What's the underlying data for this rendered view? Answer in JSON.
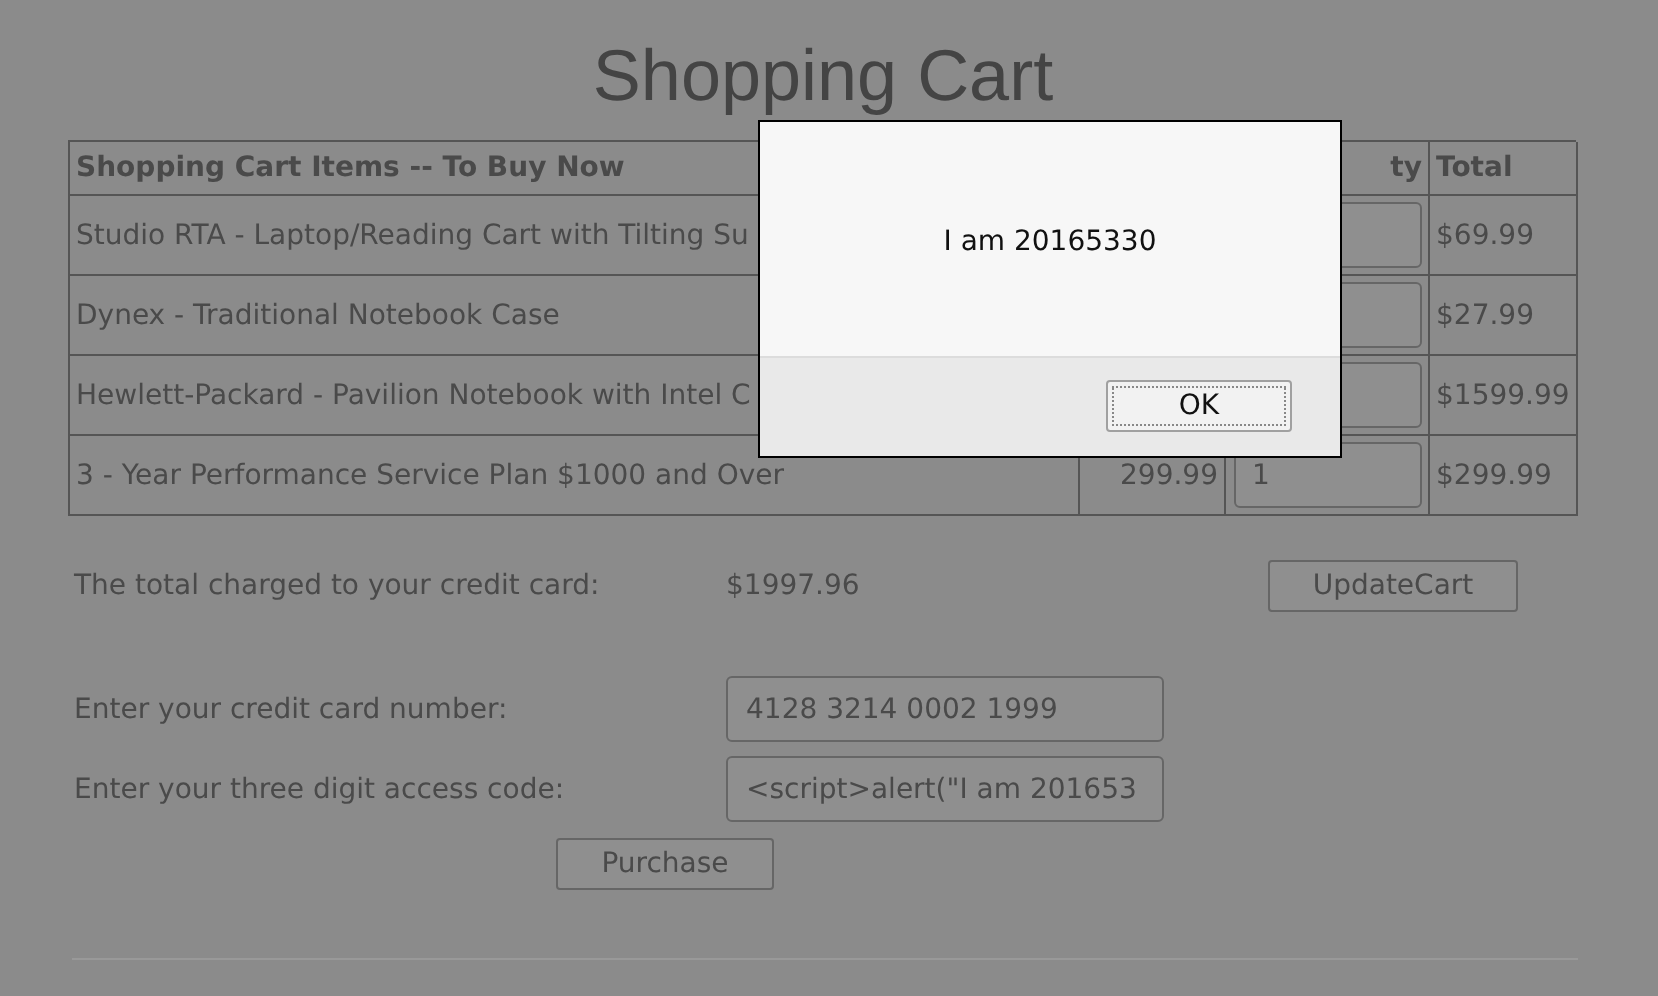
{
  "title": "Shopping Cart",
  "table": {
    "header": {
      "items": "Shopping Cart Items -- To Buy Now",
      "column_3": "ty",
      "total": "Total"
    },
    "rows": [
      {
        "item": "Studio RTA - Laptop/Reading Cart with Tilting Su",
        "total": "$69.99"
      },
      {
        "item": "Dynex - Traditional Notebook Case",
        "total": "$27.99"
      },
      {
        "item": "Hewlett-Packard - Pavilion Notebook with Intel C",
        "total": "$1599.99"
      },
      {
        "item": "3 - Year Performance Service Plan $1000 and Over",
        "price": "299.99",
        "quantity": "1",
        "total": "$299.99"
      }
    ]
  },
  "summary": {
    "label": "The total charged to your credit card:",
    "value": "$1997.96",
    "button": "UpdateCart"
  },
  "form": {
    "card_label": "Enter your credit card number:",
    "card_value": "4128 3214 0002 1999",
    "code_label": "Enter your three digit access code:",
    "code_value": "<script>alert(\"I am 201653",
    "button": "Purchase"
  },
  "dialog": {
    "message": "I am 20165330",
    "button": "OK"
  }
}
